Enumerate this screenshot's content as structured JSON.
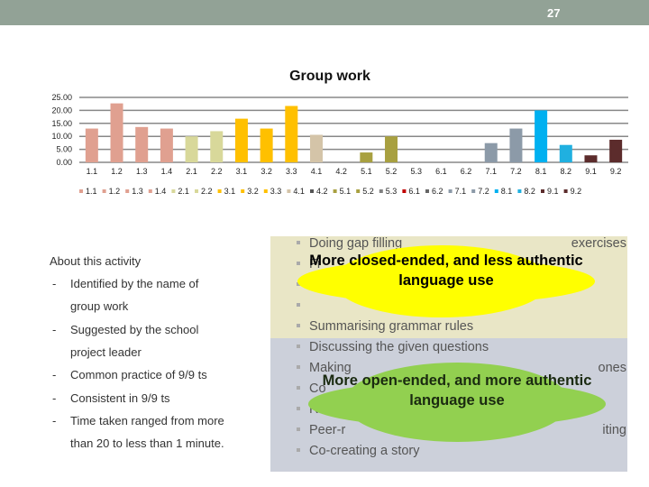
{
  "header": {
    "page_number": "27",
    "color": "#92a296"
  },
  "chart_data": {
    "type": "bar",
    "title": "Group work",
    "categories": [
      "1.1",
      "1.2",
      "1.3",
      "1.4",
      "2.1",
      "2.2",
      "3.1",
      "3.2",
      "3.3",
      "4.1",
      "4.2",
      "5.1",
      "5.2",
      "5.3",
      "6.1",
      "6.2",
      "7.1",
      "7.2",
      "8.1",
      "8.2",
      "9.1",
      "9.2"
    ],
    "values": [
      13,
      22.7,
      13.6,
      13,
      10,
      12,
      16.8,
      13,
      21.7,
      10.6,
      0,
      3.8,
      10,
      0,
      0,
      0,
      7.4,
      13,
      20,
      6.7,
      2.7,
      8.7
    ],
    "colors": [
      "#e0a090",
      "#e0a090",
      "#e0a090",
      "#e0a090",
      "#d8d89a",
      "#d8d89a",
      "#ffc000",
      "#ffc000",
      "#ffc000",
      "#d4c4a8",
      "#555555",
      "#a8a040",
      "#a8a040",
      "#808080",
      "#c00000",
      "#666666",
      "#8c9aa8",
      "#8c9aa8",
      "#00b0f0",
      "#20b0e0",
      "#5c2c2c",
      "#5c2c2c"
    ],
    "yticks": [
      "0.00",
      "5.00",
      "10.00",
      "15.00",
      "20.00",
      "25.00"
    ],
    "ylim": [
      0,
      25
    ],
    "grid": true,
    "legend": "bottom"
  },
  "left": {
    "heading": "About this activity",
    "points": [
      {
        "dash": "-",
        "lines": [
          "Identified by the name of",
          "group work"
        ]
      },
      {
        "dash": "-",
        "lines": [
          "Suggested by the school",
          "project leader"
        ]
      },
      {
        "dash": "-",
        "lines": [
          "Common practice of 9/9 ts"
        ]
      },
      {
        "dash": "-",
        "lines": [
          "Consistent in 9/9 ts"
        ]
      },
      {
        "dash": "-",
        "lines": [
          "Time taken ranged from more",
          "than 20 to less than 1 minute."
        ]
      }
    ]
  },
  "closed": {
    "items": [
      {
        "start": "Doing gap filling",
        "end": "exercises"
      },
      {
        "start": "Fi",
        "end": ""
      },
      {
        "start": "",
        "end": ""
      },
      {
        "start": "",
        "end": ""
      },
      {
        "start": "Summarising grammar rules",
        "end": ""
      }
    ],
    "cloud": "More closed-ended, and less authentic language use",
    "cloud_color": "#ffff00",
    "panel_color": "#e9e6c6"
  },
  "open": {
    "items": [
      {
        "start": "Discussing the given questions",
        "end": ""
      },
      {
        "start": "Making",
        "end": "ones"
      },
      {
        "start": "Co",
        "end": ""
      },
      {
        "start": "R",
        "end": ""
      },
      {
        "start": "Peer-r",
        "end": "iting"
      },
      {
        "start": "Co-creating a story",
        "end": ""
      }
    ],
    "cloud": "More open-ended, and more authentic language use",
    "cloud_color": "#92d050",
    "panel_color": "#ccd0da"
  }
}
